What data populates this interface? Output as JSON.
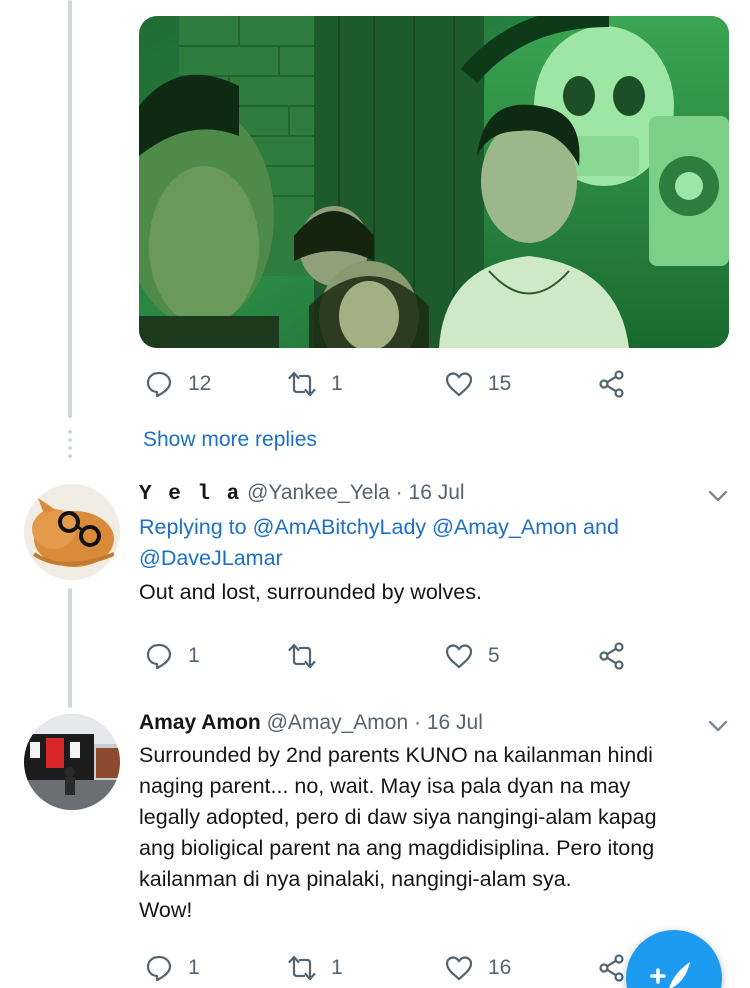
{
  "colors": {
    "accent": "#1d9bf0",
    "link": "#1d6fc7",
    "muted": "#536471",
    "thread_line": "#cfd9de"
  },
  "media_tweet": {
    "reply_count": "12",
    "retweet_count": "1",
    "like_count": "15",
    "icons": [
      "reply-icon",
      "retweet-icon",
      "like-icon",
      "share-icon"
    ]
  },
  "show_more_replies": "Show more replies",
  "tweets": [
    {
      "display_name": "Y e l a",
      "handle": "@Yankee_Yela",
      "separator": "·",
      "date": "16 Jul",
      "replying_prefix": "Replying to",
      "mention_1": "@AmABitchyLady",
      "mention_2": "@Amay_Amon",
      "and_word": "and",
      "mention_3": "@DaveJLamar",
      "text": "Out and lost, surrounded by wolves.",
      "reply_count": "1",
      "retweet_count": "",
      "like_count": "5"
    },
    {
      "display_name": "Amay Amon",
      "handle": "@Amay_Amon",
      "separator": "·",
      "date": "16 Jul",
      "lines": [
        "Surrounded by 2nd parents KUNO na kailanman hindi",
        "naging parent... no, wait. May isa pala dyan na may",
        "legally adopted, pero di daw siya nangingi-alam kapag",
        "ang bioligical parent na ang magdidisiplina. Pero itong",
        "kailanman di nya pinalaki, nangingi-alam sya.",
        "Wow!"
      ],
      "reply_count": "1",
      "retweet_count": "1",
      "like_count": "16"
    }
  ],
  "compose_button_icon": "compose-tweet-icon"
}
